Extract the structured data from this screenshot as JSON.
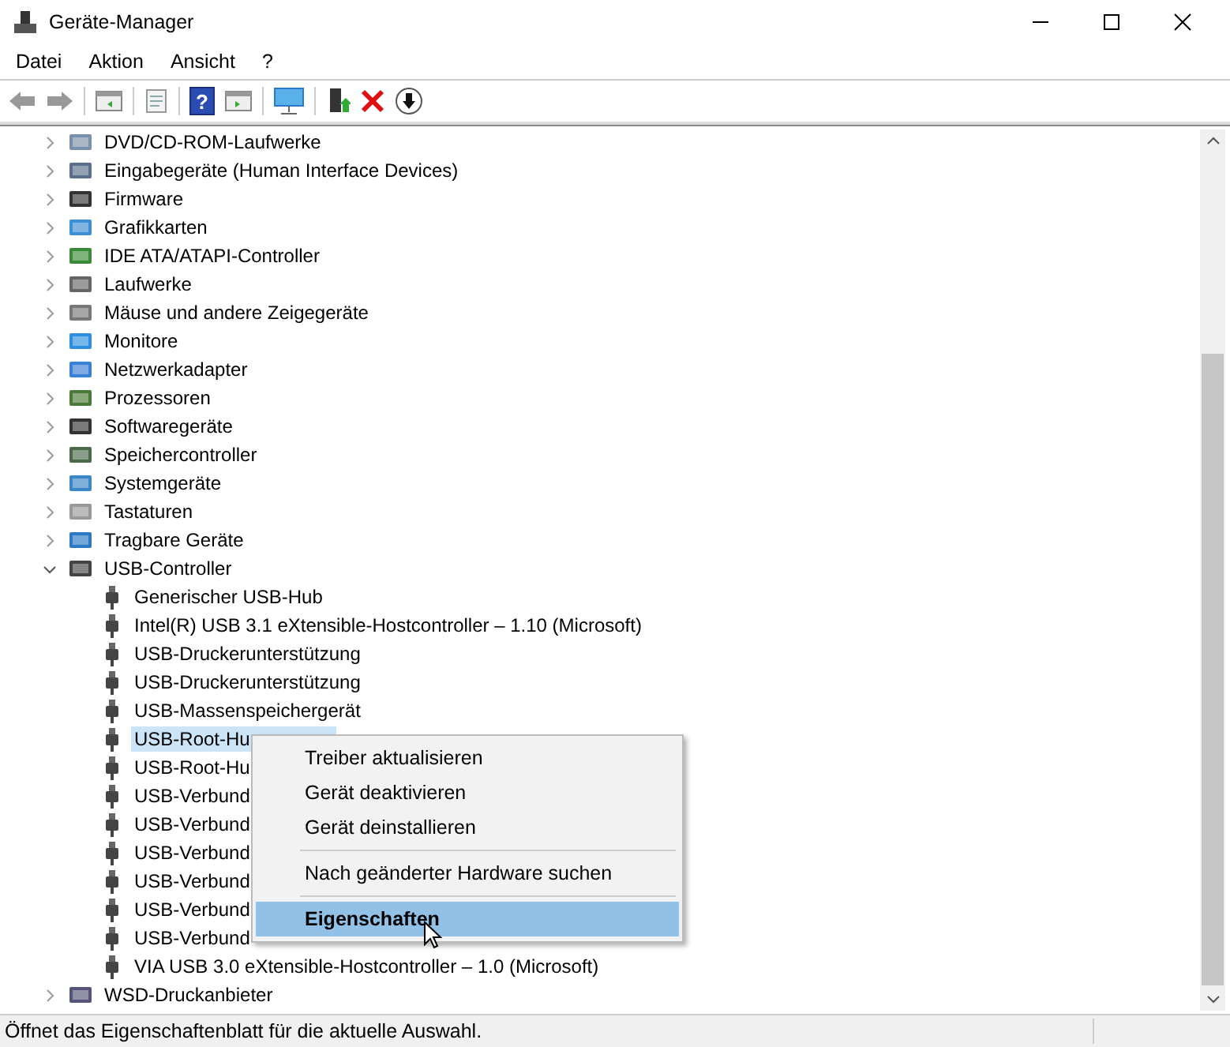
{
  "window": {
    "title": "Geräte-Manager"
  },
  "menu": [
    "Datei",
    "Aktion",
    "Ansicht",
    "?"
  ],
  "toolbar": {
    "help_glyph": "?"
  },
  "tree": [
    {
      "label": "DVD/CD-ROM-Laufwerke",
      "expanded": false
    },
    {
      "label": "Eingabegeräte (Human Interface Devices)",
      "expanded": false
    },
    {
      "label": "Firmware",
      "expanded": false
    },
    {
      "label": "Grafikkarten",
      "expanded": false
    },
    {
      "label": "IDE ATA/ATAPI-Controller",
      "expanded": false
    },
    {
      "label": "Laufwerke",
      "expanded": false
    },
    {
      "label": "Mäuse und andere Zeigegeräte",
      "expanded": false
    },
    {
      "label": "Monitore",
      "expanded": false
    },
    {
      "label": "Netzwerkadapter",
      "expanded": false
    },
    {
      "label": "Prozessoren",
      "expanded": false
    },
    {
      "label": "Softwaregeräte",
      "expanded": false
    },
    {
      "label": "Speichercontroller",
      "expanded": false
    },
    {
      "label": "Systemgeräte",
      "expanded": false
    },
    {
      "label": "Tastaturen",
      "expanded": false
    },
    {
      "label": "Tragbare Geräte",
      "expanded": false
    },
    {
      "label": "USB-Controller",
      "expanded": true,
      "children": [
        {
          "label": "Generischer USB-Hub",
          "selected": false
        },
        {
          "label": "Intel(R) USB 3.1 eXtensible-Hostcontroller – 1.10 (Microsoft)",
          "selected": false
        },
        {
          "label": "USB-Druckerunterstützung",
          "selected": false
        },
        {
          "label": "USB-Druckerunterstützung",
          "selected": false
        },
        {
          "label": "USB-Massenspeichergerät",
          "selected": false
        },
        {
          "label": "USB-Root-Hu",
          "selected": true
        },
        {
          "label": "USB-Root-Hu",
          "selected": false
        },
        {
          "label": "USB-Verbund",
          "selected": false
        },
        {
          "label": "USB-Verbund",
          "selected": false
        },
        {
          "label": "USB-Verbund",
          "selected": false
        },
        {
          "label": "USB-Verbund",
          "selected": false
        },
        {
          "label": "USB-Verbund",
          "selected": false
        },
        {
          "label": "USB-Verbund",
          "selected": false
        },
        {
          "label": "VIA USB 3.0 eXtensible-Hostcontroller – 1.0 (Microsoft)",
          "selected": false
        }
      ]
    },
    {
      "label": "WSD-Druckanbieter",
      "expanded": false
    }
  ],
  "context_menu": [
    {
      "kind": "item",
      "label": "Treiber aktualisieren",
      "selected": false,
      "default": false
    },
    {
      "kind": "item",
      "label": "Gerät deaktivieren",
      "selected": false,
      "default": false
    },
    {
      "kind": "item",
      "label": "Gerät deinstallieren",
      "selected": false,
      "default": false
    },
    {
      "kind": "separator"
    },
    {
      "kind": "item",
      "label": "Nach geänderter Hardware suchen",
      "selected": false,
      "default": false
    },
    {
      "kind": "separator"
    },
    {
      "kind": "item",
      "label": "Eigenschaften",
      "selected": true,
      "default": true
    }
  ],
  "status_bar": "Öffnet das Eigenschaftenblatt für die aktuelle Auswahl."
}
